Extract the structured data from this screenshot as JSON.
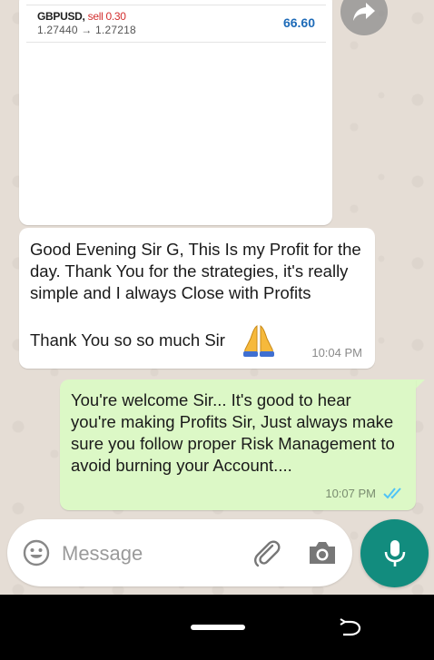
{
  "trade": {
    "symbol": "GBPUSD,",
    "side": "sell 0.30",
    "prices": "1.27440 → 1.27218",
    "profit": "66.60"
  },
  "incoming_message": {
    "text": "Good Evening Sir G, This Is my Profit for the day. Thank You for the strategies, it's really simple and I always Close with Profits",
    "text_line2": "Thank You so so much Sir",
    "emoji": "folded-hands",
    "time": "10:04 PM"
  },
  "outgoing_message": {
    "text": "You're welcome Sir... It's good to hear you're making Profits Sir, Just always make sure you follow proper Risk Management to avoid burning your Account....",
    "time": "10:07 PM",
    "status": "read"
  },
  "composer": {
    "placeholder": "Message"
  },
  "colors": {
    "outgoing_bubble": "#dcf8c6",
    "incoming_bubble": "#ffffff",
    "accent": "#128c7e",
    "read_ticks": "#4fc3f7",
    "sell_red": "#d32f2f",
    "profit_blue": "#1e6bb8"
  }
}
